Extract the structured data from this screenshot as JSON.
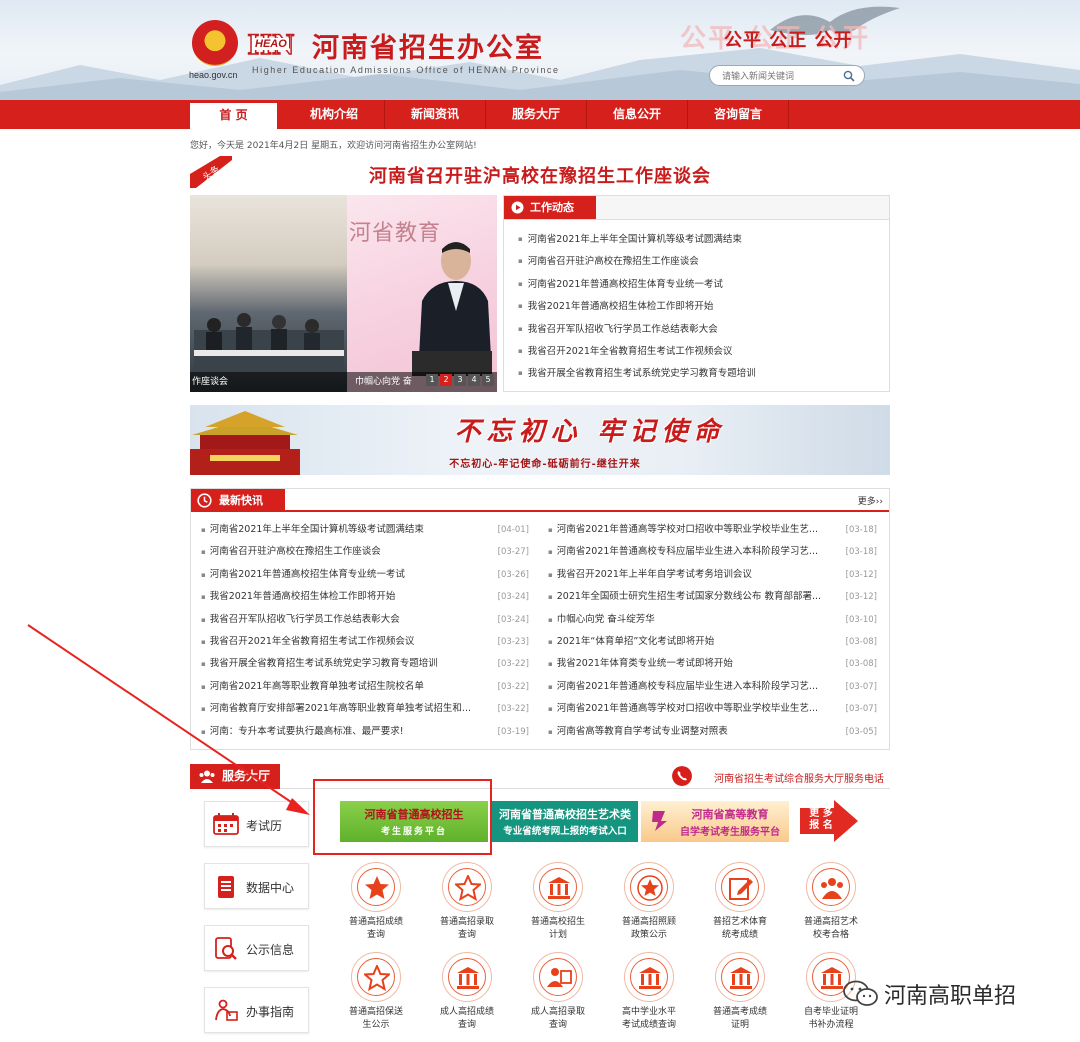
{
  "header": {
    "domain_label": "heao.gov.cn",
    "logo_mark": "HN",
    "logo_sub": "HEAO",
    "title": "河南省招生办公室",
    "subtitle_en": "Higher Education Admissions Office of HENAN Province",
    "slogan": "公平 公正 公开",
    "search_placeholder": "请输入新闻关键词"
  },
  "nav": {
    "items": [
      "首 页",
      "机构介绍",
      "新闻资讯",
      "服务大厅",
      "信息公开",
      "咨询留言"
    ],
    "active_index": 0
  },
  "welcome": "您好，今天是 2021年4月2日 星期五，欢迎访问河南省招生办公室网站!",
  "headline": {
    "tag": "头条",
    "title": "河南省召开驻沪高校在豫招生工作座谈会"
  },
  "slideshow": {
    "caption_left": "作座谈会",
    "caption_right": "巾帼心向党  奋",
    "backdrop_text": "河省教育",
    "pages": [
      "1",
      "2",
      "3",
      "4",
      "5"
    ],
    "active_page": 2
  },
  "work_news": {
    "title": "工作动态",
    "items": [
      "河南省2021年上半年全国计算机等级考试圆满结束",
      "河南省召开驻沪高校在豫招生工作座谈会",
      "河南省2021年普通高校招生体育专业统一考试",
      "我省2021年普通高校招生体检工作即将开始",
      "我省召开军队招收飞行学员工作总结表彰大会",
      "我省召开2021年全省教育招生考试工作视频会议",
      "我省开展全省教育招生考试系统党史学习教育专题培训"
    ]
  },
  "banner": {
    "main": "不忘初心  牢记使命",
    "sub": "不忘初心-牢记使命-砥砺前行-继往开来"
  },
  "latest": {
    "title": "最新快讯",
    "more": "更多››",
    "left": [
      {
        "title": "河南省2021年上半年全国计算机等级考试圆满结束",
        "date": "[04-01]"
      },
      {
        "title": "河南省召开驻沪高校在豫招生工作座谈会",
        "date": "[03-27]"
      },
      {
        "title": "河南省2021年普通高校招生体育专业统一考试",
        "date": "[03-26]"
      },
      {
        "title": "我省2021年普通高校招生体检工作即将开始",
        "date": "[03-24]"
      },
      {
        "title": "我省召开军队招收飞行学员工作总结表彰大会",
        "date": "[03-24]"
      },
      {
        "title": "我省召开2021年全省教育招生考试工作视频会议",
        "date": "[03-23]"
      },
      {
        "title": "我省开展全省教育招生考试系统党史学习教育专题培训",
        "date": "[03-22]"
      },
      {
        "title": "河南省2021年高等职业教育单独考试招生院校名单",
        "date": "[03-22]"
      },
      {
        "title": "河南省教育厅安排部署2021年高等职业教育单独考试招生和...",
        "date": "[03-22]"
      },
      {
        "title": "河南：专升本考试要执行最高标准、最严要求!",
        "date": "[03-19]"
      }
    ],
    "right": [
      {
        "title": "河南省2021年普通高等学校对口招收中等职业学校毕业生艺...",
        "date": "[03-18]"
      },
      {
        "title": "河南省2021年普通高校专科应届毕业生进入本科阶段学习艺...",
        "date": "[03-18]"
      },
      {
        "title": "我省召开2021年上半年自学考试考务培训会议",
        "date": "[03-12]"
      },
      {
        "title": "2021年全国硕士研究生招生考试国家分数线公布 教育部部署...",
        "date": "[03-12]"
      },
      {
        "title": "巾帼心向党   奋斗绽芳华",
        "date": "[03-10]"
      },
      {
        "title": "2021年“体育单招”文化考试即将开始",
        "date": "[03-08]"
      },
      {
        "title": "我省2021年体育类专业统一考试即将开始",
        "date": "[03-08]"
      },
      {
        "title": "河南省2021年普通高校专科应届毕业生进入本科阶段学习艺...",
        "date": "[03-07]"
      },
      {
        "title": "河南省2021年普通高等学校对口招收中等职业学校毕业生艺...",
        "date": "[03-07]"
      },
      {
        "title": "河南省高等教育自学考试专业调整对照表",
        "date": "[03-05]"
      }
    ]
  },
  "service": {
    "title": "服务大厅",
    "phone_text": "河南省招生考试综合服务大厅服务电话",
    "side_buttons": [
      "考试历",
      "数据中心",
      "公示信息",
      "办事指南"
    ],
    "entry1": {
      "line1": "河南省普通高校招生",
      "line2": "考生服务平台"
    },
    "entry2": {
      "line1": "河南省普通高校招生艺术类",
      "line2": "专业省统考网上报的考试入口"
    },
    "entry3": {
      "line1": "河南省高等教育",
      "line2": "自学考试考生服务平台"
    },
    "entry4": {
      "line1": "更 多",
      "line2": "报 名"
    },
    "icons": [
      {
        "label": "普通高招成绩查询",
        "icon": "star-filled-icon"
      },
      {
        "label": "普通高招录取查询",
        "icon": "star-outline-icon"
      },
      {
        "label": "普通高校招生计划",
        "icon": "building-icon"
      },
      {
        "label": "普通高招照顾政策公示",
        "icon": "star-badge-icon"
      },
      {
        "label": "普招艺术体育统考成绩",
        "icon": "edit-icon"
      },
      {
        "label": "普通高招艺术校考合格",
        "icon": "group-icon"
      },
      {
        "label": "普通高招保送生公示",
        "icon": "star-outline-icon"
      },
      {
        "label": "成人高招成绩查询",
        "icon": "building-icon"
      },
      {
        "label": "成人高招录取查询",
        "icon": "users-icon"
      },
      {
        "label": "高中学业水平考试成绩查询",
        "icon": "building-icon"
      },
      {
        "label": "普通高考成绩证明",
        "icon": "building-icon"
      },
      {
        "label": "自考毕业证明书补办流程",
        "icon": "building-icon"
      }
    ]
  },
  "watermark": "河南高职单招",
  "colors": {
    "brand_red": "#d6201c",
    "accent_green": "#159480",
    "annotation_red": "#e8231f"
  }
}
